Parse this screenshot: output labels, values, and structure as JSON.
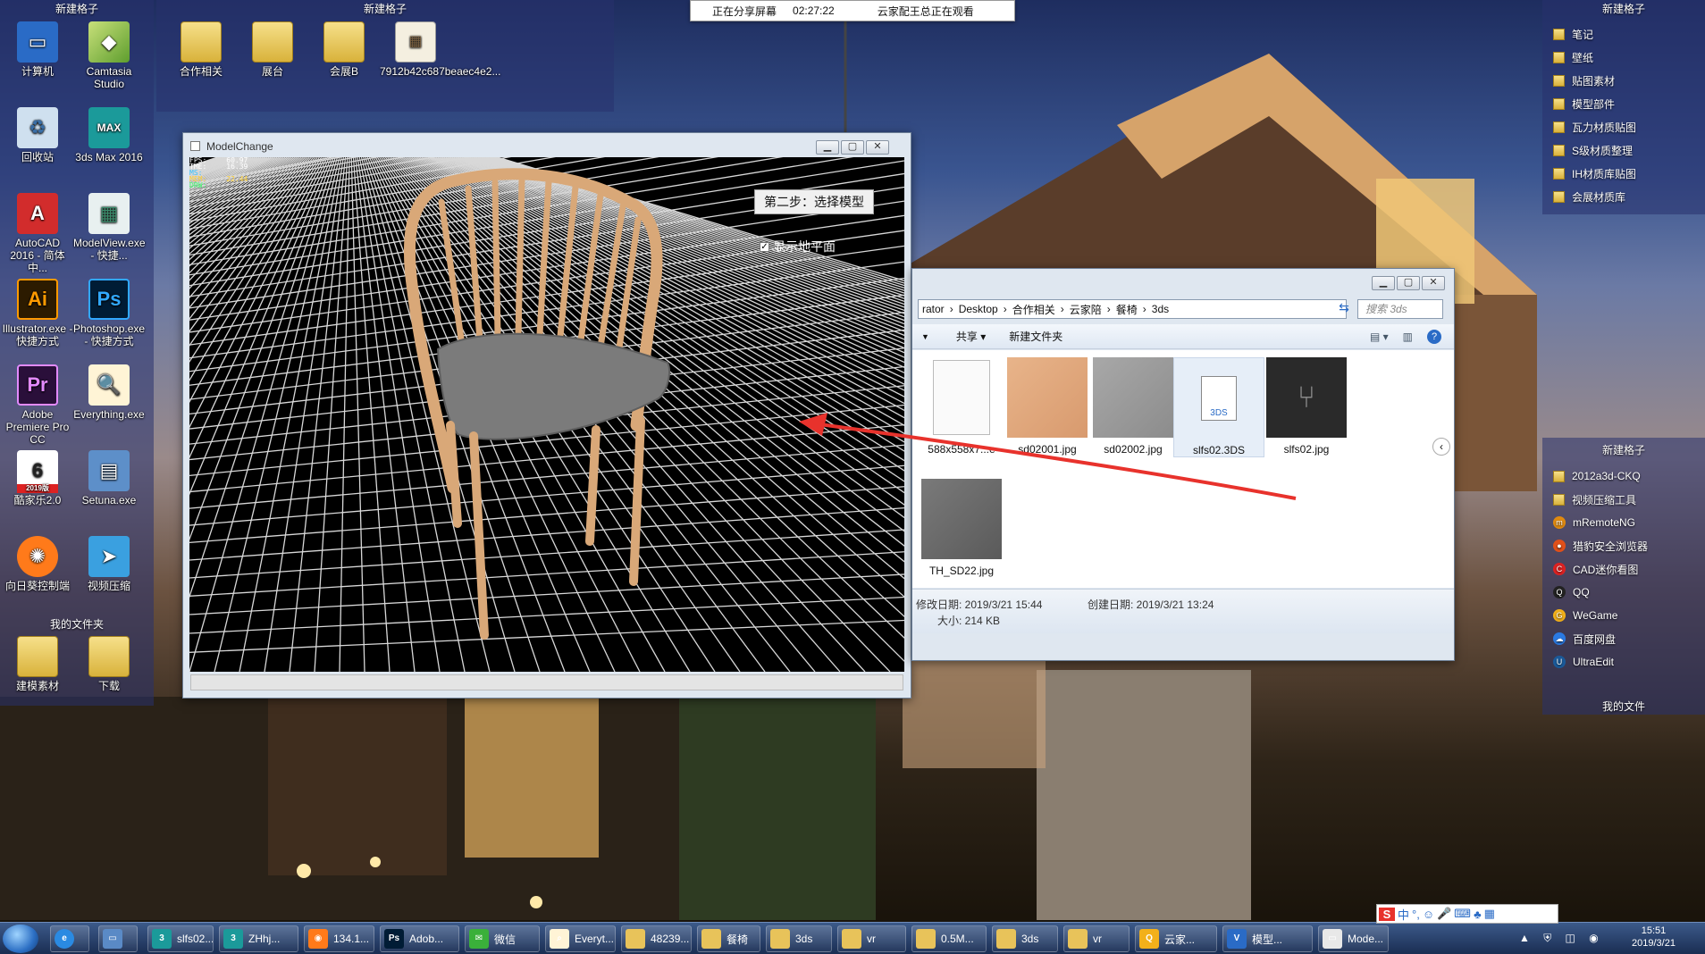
{
  "share_bar": {
    "status": "正在分享屏幕",
    "timer": "02:27:22",
    "viewer": "云家配王总正在观看"
  },
  "desktop_grids": {
    "left_title": "新建格子",
    "middle_title": "新建格子",
    "right_top_title": "新建格子",
    "right_mid_title": "新建格子",
    "right_bottom_label": "我的文件",
    "my_files_title": "我的文件夹"
  },
  "desktop_icons": [
    {
      "label": "计算机",
      "icon": "computer-icon"
    },
    {
      "label": "Camtasia Studio",
      "icon": "camtasia-icon"
    },
    {
      "label": "回收站",
      "icon": "recycle-bin-icon"
    },
    {
      "label": "3ds Max 2016",
      "icon": "3dsmax-icon"
    },
    {
      "label": "AutoCAD 2016 - 简体中...",
      "icon": "autocad-icon"
    },
    {
      "label": "ModelView.exe - 快捷...",
      "icon": "modelview-icon"
    },
    {
      "label": "Illustrator.exe - 快捷方式",
      "icon": "illustrator-icon"
    },
    {
      "label": "Photoshop.exe - 快捷方式",
      "icon": "photoshop-icon"
    },
    {
      "label": "Adobe Premiere Pro CC",
      "icon": "premiere-icon"
    },
    {
      "label": "Everything.exe",
      "icon": "everything-icon"
    },
    {
      "label": "酷家乐2.0",
      "icon": "kujiale-icon"
    },
    {
      "label": "Setuna.exe",
      "icon": "setuna-icon"
    },
    {
      "label": "向日葵控制端",
      "icon": "sunflower-icon"
    },
    {
      "label": "视频压缩",
      "icon": "video-compress-icon"
    },
    {
      "label": "建模素材",
      "icon": "folder-icon"
    },
    {
      "label": "下载",
      "icon": "folder-icon"
    },
    {
      "label": "合作相关",
      "icon": "folder-icon"
    },
    {
      "label": "展台",
      "icon": "folder-icon"
    },
    {
      "label": "会展B",
      "icon": "folder-icon"
    },
    {
      "label": "7912b42c687beaec4e2...",
      "icon": "image-file-icon"
    }
  ],
  "kujiale_badge": "2019版",
  "right_top_list": [
    "笔记",
    "壁纸",
    "贴图素材",
    "模型部件",
    "瓦力材质贴图",
    "S级材质整理",
    "IH材质库贴图",
    "会展材质库"
  ],
  "right_mid_list": [
    "2012a3d-CKQ",
    "视频压缩工具",
    "mRemoteNG",
    "猎豹安全浏览器",
    "CAD迷你看图",
    "QQ",
    "WeGame",
    "百度网盘",
    "UltraEdit"
  ],
  "model_window": {
    "title": "ModelChange",
    "stats": [
      {
        "label": "FPS:",
        "value": "60.97"
      },
      {
        "label": "TME:",
        "value": "16.39"
      },
      {
        "label": "MS:",
        "value": ""
      },
      {
        "label": "MEM:",
        "value": "22.44"
      },
      {
        "label": "DRW:",
        "value": ""
      }
    ],
    "step_button": "第二步：选择模型",
    "checkbox_label": "显示地平面",
    "checkbox_checked": true
  },
  "explorer": {
    "breadcrumb": [
      "rator",
      "Desktop",
      "合作相关",
      "云家陪",
      "餐椅",
      "3ds"
    ],
    "search_placeholder": "搜索 3ds",
    "toolbar": {
      "share": "共享",
      "new_folder": "新建文件夹"
    },
    "files": [
      {
        "name": "588x558x7...e",
        "kind": "blank"
      },
      {
        "name": "sd02001.jpg",
        "kind": "wood"
      },
      {
        "name": "sd02002.jpg",
        "kind": "gray"
      },
      {
        "name": "slfs02.3DS",
        "kind": "3ds"
      },
      {
        "name": "slfs02.jpg",
        "kind": "chair"
      },
      {
        "name": "TH_SD22.jpg",
        "kind": "dark-gray"
      }
    ],
    "details": {
      "modified": "修改日期: 2019/3/21 15:44",
      "created": "创建日期: 2019/3/21 13:24",
      "size": "大小: 214 KB"
    }
  },
  "taskbar": {
    "items": [
      {
        "label": "slfs02...",
        "icon": "3dsmax-icon"
      },
      {
        "label": "ZHhj...",
        "icon": "3dsmax-icon"
      },
      {
        "label": "134.1...",
        "icon": "browser-icon"
      },
      {
        "label": "Adob...",
        "icon": "photoshop-icon"
      },
      {
        "label": "微信",
        "icon": "wechat-icon"
      },
      {
        "label": "Everyt...",
        "icon": "everything-icon"
      },
      {
        "label": "48239...",
        "icon": "folder-icon"
      },
      {
        "label": "餐椅",
        "icon": "folder-icon"
      },
      {
        "label": "3ds",
        "icon": "folder-icon"
      },
      {
        "label": "vr",
        "icon": "folder-icon"
      },
      {
        "label": "0.5M...",
        "icon": "folder-icon"
      },
      {
        "label": "3ds",
        "icon": "folder-icon"
      },
      {
        "label": "vr",
        "icon": "folder-icon"
      },
      {
        "label": "云家...",
        "icon": "qq-icon"
      },
      {
        "label": "模型...",
        "icon": "app-icon"
      },
      {
        "label": "Mode...",
        "icon": "window-icon"
      }
    ],
    "ime_label": "中",
    "clock_time": "15:51",
    "clock_date": "2019/3/21"
  },
  "colors": {
    "arrow": "#e8322c",
    "chair_wood": "#d7a878",
    "chair_seat": "#7b7b7b"
  }
}
